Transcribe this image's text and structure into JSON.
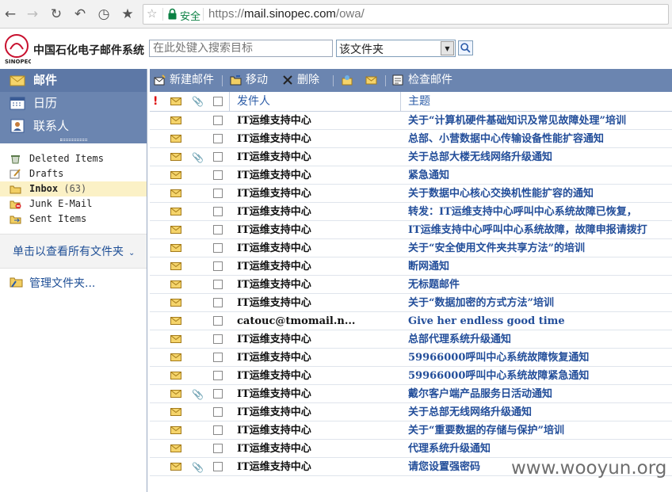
{
  "browser": {
    "secure_label": "安全",
    "url_scheme": "https://",
    "url_host": "mail.sinopec.com",
    "url_path": "/owa/"
  },
  "header": {
    "app_title": "中国石化电子邮件系统",
    "search_placeholder": "在此处键入搜索目标",
    "scope_value": "该文件夹"
  },
  "nav": {
    "tabs": [
      {
        "label": "邮件",
        "icon": "mail-icon"
      },
      {
        "label": "日历",
        "icon": "calendar-icon"
      },
      {
        "label": "联系人",
        "icon": "contacts-icon"
      }
    ],
    "folders": [
      {
        "label": "Deleted Items",
        "count": "",
        "icon": "trash-icon"
      },
      {
        "label": "Drafts",
        "count": "",
        "icon": "drafts-icon"
      },
      {
        "label": "Inbox",
        "count": "(63)",
        "icon": "inbox-icon"
      },
      {
        "label": "Junk E-Mail",
        "count": "",
        "icon": "junk-icon"
      },
      {
        "label": "Sent Items",
        "count": "",
        "icon": "sent-icon"
      }
    ],
    "all_folders": "单击以查看所有文件夹",
    "manage_folders": "管理文件夹..."
  },
  "toolbar": {
    "new_mail": "新建邮件",
    "move": "移动",
    "delete": "删除",
    "check_mail": "检查邮件"
  },
  "list": {
    "col_from": "发件人",
    "col_subject": "主题",
    "rows": [
      {
        "from": "IT运维支持中心",
        "subject": "关于“计算机硬件基础知识及常见故障处理”培训",
        "attach": false
      },
      {
        "from": "IT运维支持中心",
        "subject": "总部、小营数据中心传输设备性能扩容通知",
        "attach": false
      },
      {
        "from": "IT运维支持中心",
        "subject": "关于总部大楼无线网络升级通知",
        "attach": true
      },
      {
        "from": "IT运维支持中心",
        "subject": "紧急通知",
        "attach": false
      },
      {
        "from": "IT运维支持中心",
        "subject": "关于数据中心核心交换机性能扩容的通知",
        "attach": false
      },
      {
        "from": "IT运维支持中心",
        "subject": "转发：IT运维支持中心呼叫中心系统故障已恢复，",
        "attach": false
      },
      {
        "from": "IT运维支持中心",
        "subject": "IT运维支持中心呼叫中心系统故障，故障申报请拨打",
        "attach": false
      },
      {
        "from": "IT运维支持中心",
        "subject": "关于“安全使用文件夹共享方法”的培训",
        "attach": false
      },
      {
        "from": "IT运维支持中心",
        "subject": "断网通知",
        "attach": false
      },
      {
        "from": "IT运维支持中心",
        "subject": "无标题邮件",
        "attach": false
      },
      {
        "from": "IT运维支持中心",
        "subject": "关于“数据加密的方式方法”培训",
        "attach": false
      },
      {
        "from": "catouc@tmomail.n...",
        "subject": "Give her endless good time",
        "attach": false
      },
      {
        "from": "IT运维支持中心",
        "subject": "总部代理系统升级通知",
        "attach": false
      },
      {
        "from": "IT运维支持中心",
        "subject": "59966000呼叫中心系统故障恢复通知",
        "attach": false
      },
      {
        "from": "IT运维支持中心",
        "subject": "59966000呼叫中心系统故障紧急通知",
        "attach": false
      },
      {
        "from": "IT运维支持中心",
        "subject": "戴尔客户端产品服务日活动通知",
        "attach": true
      },
      {
        "from": "IT运维支持中心",
        "subject": "关于总部无线网络升级通知",
        "attach": false
      },
      {
        "from": "IT运维支持中心",
        "subject": "关于“重要数据的存储与保护”培训",
        "attach": false
      },
      {
        "from": "IT运维支持中心",
        "subject": "代理系统升级通知",
        "attach": false
      },
      {
        "from": "IT运维支持中心",
        "subject": "请您设置强密码",
        "attach": true
      }
    ]
  },
  "watermark": "www.wooyun.org",
  "colors": {
    "nav_blue": "#6b85b0",
    "link_blue": "#234e9a",
    "secure_green": "#0b8043"
  }
}
